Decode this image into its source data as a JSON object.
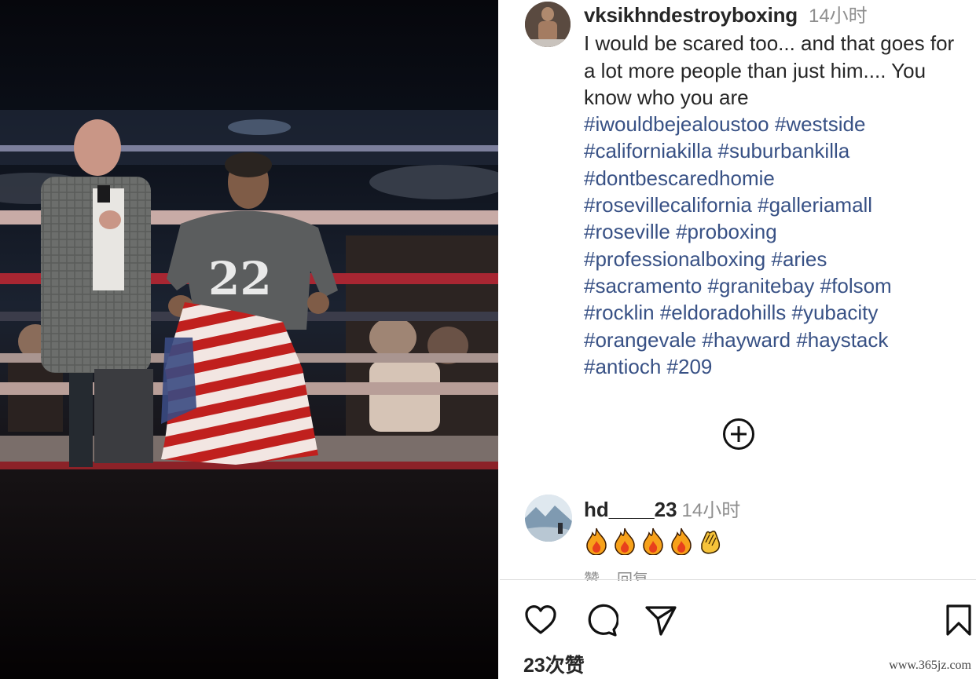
{
  "post": {
    "username": "vksikhndestroyboxing",
    "time": "14小时",
    "caption": "I would be scared too... and that goes for a lot more people than just him.... You know who you are",
    "hashtags": [
      "#iwouldbejealoustoo",
      "#westside",
      "#californiakilla",
      "#suburbankilla",
      "#dontbescaredhomie",
      "#rosevillecalifornia",
      "#galleriamall",
      "#roseville",
      "#proboxing",
      "#professionalboxing",
      "#aries",
      "#sacramento",
      "#granitebay",
      "#folsom",
      "#rocklin",
      "#eldoradohills",
      "#yubacity",
      "#orangevale",
      "#hayward",
      "#haystack",
      "#antioch",
      "#209"
    ]
  },
  "comment": {
    "username": "hd____23",
    "time": "14小时",
    "emojis": [
      "fire",
      "fire",
      "fire",
      "fire",
      "clapping-hands"
    ],
    "like_label": "赞",
    "reply_label": "回复"
  },
  "actions": {
    "icons": [
      "heart-icon",
      "comment-icon",
      "share-icon",
      "bookmark-icon"
    ],
    "likes_label": "23次赞"
  },
  "watermark": "www.365jz.com"
}
